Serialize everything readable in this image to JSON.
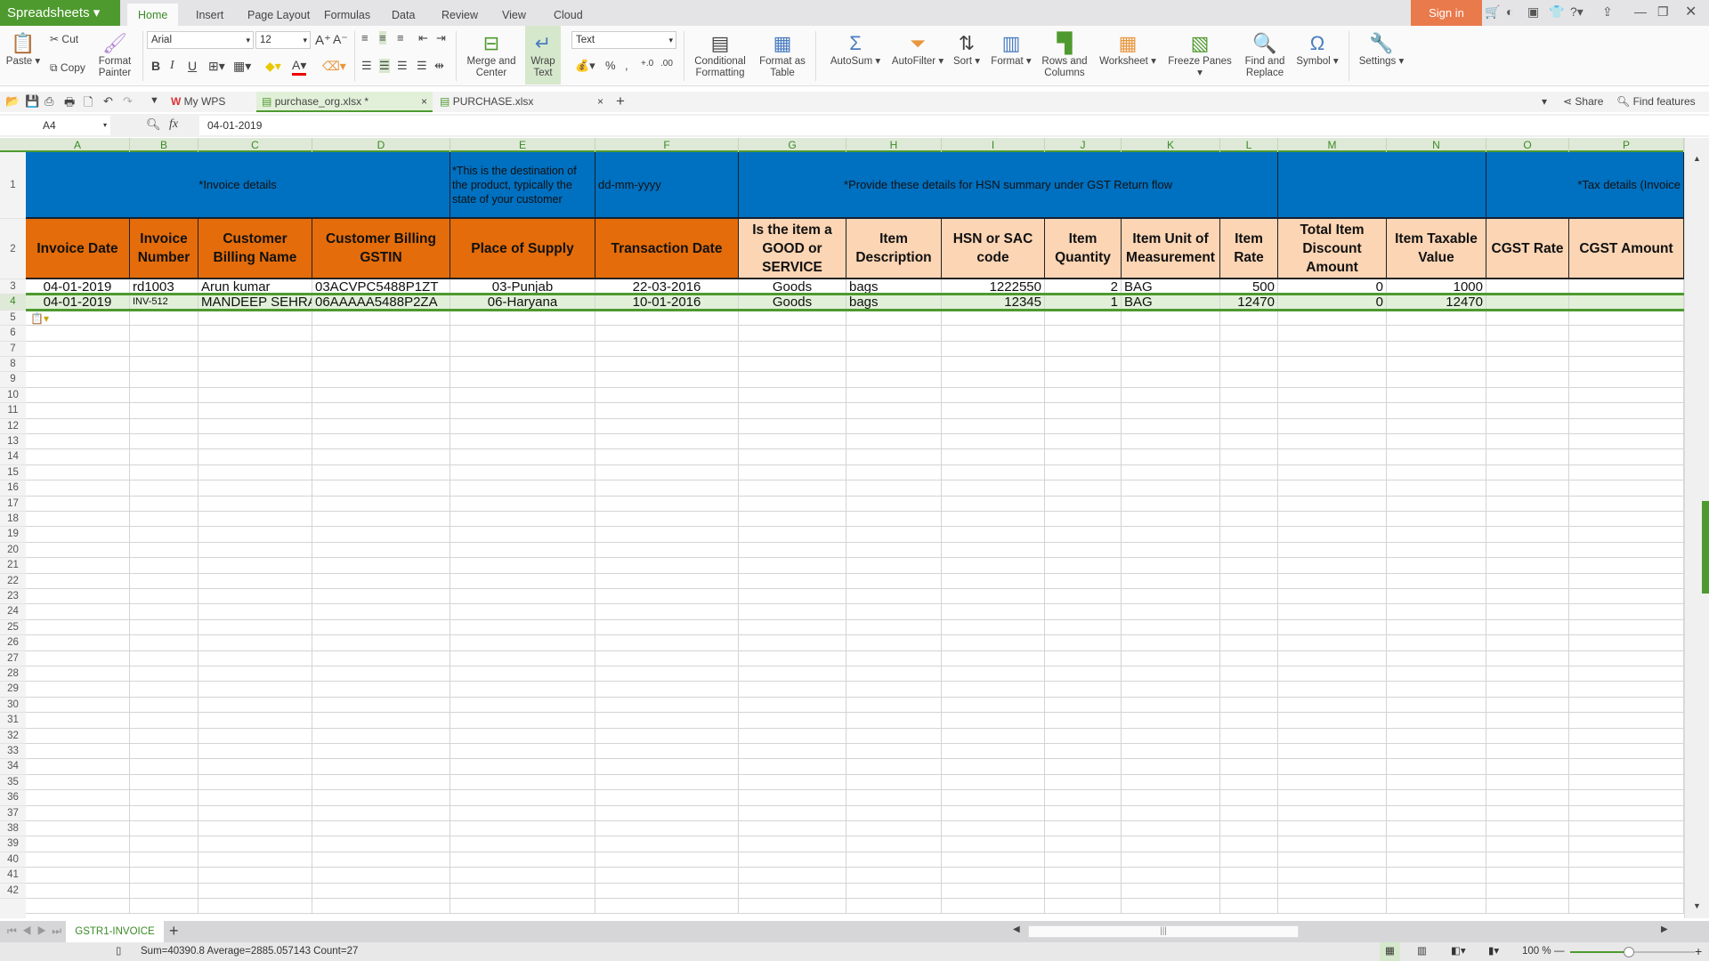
{
  "app": {
    "name": "Spreadsheets",
    "menu_tabs": [
      "Home",
      "Insert",
      "Page Layout",
      "Formulas",
      "Data",
      "Review",
      "View",
      "Cloud"
    ],
    "active_tab": "Home",
    "sign_in": "Sign in"
  },
  "ribbon": {
    "paste": "Paste",
    "cut": "Cut",
    "copy": "Copy",
    "format_painter": "Format Painter",
    "font": "Arial",
    "font_size": "12",
    "number_format": "Text",
    "bold": "B",
    "italic": "I",
    "underline": "U",
    "merge_center": "Merge and Center",
    "wrap_text": "Wrap Text",
    "conditional_formatting": "Conditional Formatting",
    "format_as_table": "Format as Table",
    "autosum": "AutoSum",
    "autofilter": "AutoFilter",
    "sort": "Sort",
    "format": "Format",
    "rows_columns": "Rows and Columns",
    "worksheet": "Worksheet",
    "freeze_panes": "Freeze Panes",
    "find_replace": "Find and Replace",
    "symbol": "Symbol",
    "settings": "Settings"
  },
  "file_tabs": [
    {
      "label": "My WPS"
    },
    {
      "label": "purchase_org.xlsx *",
      "active": true
    },
    {
      "label": "PURCHASE.xlsx"
    }
  ],
  "toolbar": {
    "share": "Share",
    "find_features": "Find features"
  },
  "formula_bar": {
    "cell_ref": "A4",
    "fx": "fx",
    "value": "04-01-2019"
  },
  "columns": [
    "A",
    "B",
    "C",
    "D",
    "E",
    "F",
    "G",
    "H",
    "I",
    "J",
    "K",
    "L",
    "M",
    "N",
    "O",
    "P"
  ],
  "header_row1": {
    "invoice_details": "*Invoice details",
    "place_note": "*This is the destination of the product, typically the state of your customer",
    "date_format": "dd-mm-yyyy",
    "hsn_note": "*Provide these details for HSN summary under GST Return flow",
    "blank": "",
    "tax_note": "*Tax details (Invoice"
  },
  "header_row2": [
    "Invoice Date",
    "Invoice Number",
    "Customer Billing Name",
    "Customer Billing GSTIN",
    "Place of Supply",
    "Transaction Date",
    "Is the item a GOOD or SERVICE",
    "Item Description",
    "HSN or SAC code",
    "Item Quantity",
    "Item Unit of Measurement",
    "Item Rate",
    "Total Item Discount Amount",
    "Item Taxable Value",
    "CGST Rate",
    "CGST Amount"
  ],
  "rows": [
    [
      "04-01-2019",
      "rd1003",
      "Arun kumar",
      "03ACVPC5488P1ZT",
      "03-Punjab",
      "22-03-2016",
      "Goods",
      "bags",
      "1222550",
      "2",
      "BAG",
      "500",
      "0",
      "1000",
      "",
      ""
    ],
    [
      "04-01-2019",
      "INV-512",
      "MANDEEP SEHRA",
      "06AAAAA5488P2ZA",
      "06-Haryana",
      "10-01-2016",
      "Goods",
      "bags",
      "12345",
      "1",
      "BAG",
      "12470",
      "0",
      "12470",
      "",
      ""
    ]
  ],
  "selected_row": 4,
  "row_numbers_max": 42,
  "sheet_tabs": [
    "GSTR1-INVOICE"
  ],
  "status": {
    "summary": "Sum=40390.8  Average=2885.057143  Count=27",
    "zoom": "100 %"
  },
  "colors": {
    "brand": "#4e9a2f",
    "header_blue": "#0070c0",
    "header_orange": "#e46c0a",
    "header_peach": "#fcd5b4",
    "sign_in": "#e97a4c"
  }
}
